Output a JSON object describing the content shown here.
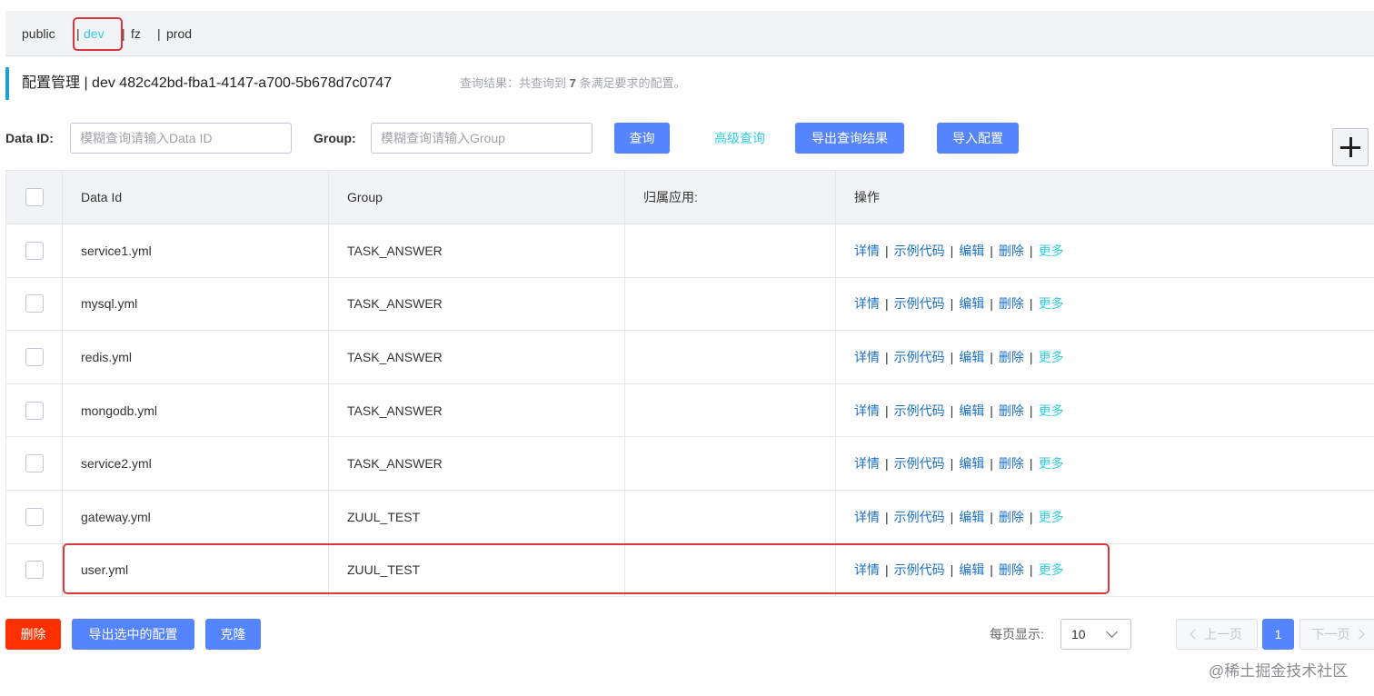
{
  "namespaces": {
    "public": "public",
    "dev": "dev",
    "fz": "fz",
    "prod": "prod",
    "separator": "|"
  },
  "title": {
    "text": "配置管理 | dev 482c42bd-fba1-4147-a700-5b678d7c0747",
    "result_prefix": "查询结果：共查询到",
    "result_count": "7",
    "result_suffix": "条满足要求的配置。"
  },
  "search": {
    "dataid_label": "Data ID:",
    "dataid_placeholder": "模糊查询请输入Data ID",
    "group_label": "Group:",
    "group_placeholder": "模糊查询请输入Group",
    "query_button": "查询",
    "advanced_link": "高级查询",
    "export_button": "导出查询结果",
    "import_button": "导入配置"
  },
  "table": {
    "headers": [
      "Data Id",
      "Group",
      "归属应用:",
      "操作"
    ],
    "rows": [
      {
        "data_id": "service1.yml",
        "group": "TASK_ANSWER",
        "app": ""
      },
      {
        "data_id": "mysql.yml",
        "group": "TASK_ANSWER",
        "app": ""
      },
      {
        "data_id": "redis.yml",
        "group": "TASK_ANSWER",
        "app": ""
      },
      {
        "data_id": "mongodb.yml",
        "group": "TASK_ANSWER",
        "app": ""
      },
      {
        "data_id": "service2.yml",
        "group": "TASK_ANSWER",
        "app": ""
      },
      {
        "data_id": "gateway.yml",
        "group": "ZUUL_TEST",
        "app": ""
      },
      {
        "data_id": "user.yml",
        "group": "ZUUL_TEST",
        "app": ""
      }
    ],
    "ops": {
      "detail": "详情",
      "sample": "示例代码",
      "edit": "编辑",
      "delete": "删除",
      "more": "更多",
      "separator": "|"
    }
  },
  "footer": {
    "delete_button": "删除",
    "export_selected_button": "导出选中的配置",
    "clone_button": "克隆",
    "page_size_label": "每页显示:",
    "page_size_value": "10",
    "prev_label": "上一页",
    "current_page": "1",
    "next_label": "下一页"
  },
  "watermark": "@稀土掘金技术社区",
  "colors": {
    "primary": "#5584ff",
    "danger": "#ff3000",
    "link": "#1b6fc3",
    "accent_cyan": "#33cde5",
    "highlight_border": "#d9363e",
    "title_accent": "#1ea0d2"
  }
}
